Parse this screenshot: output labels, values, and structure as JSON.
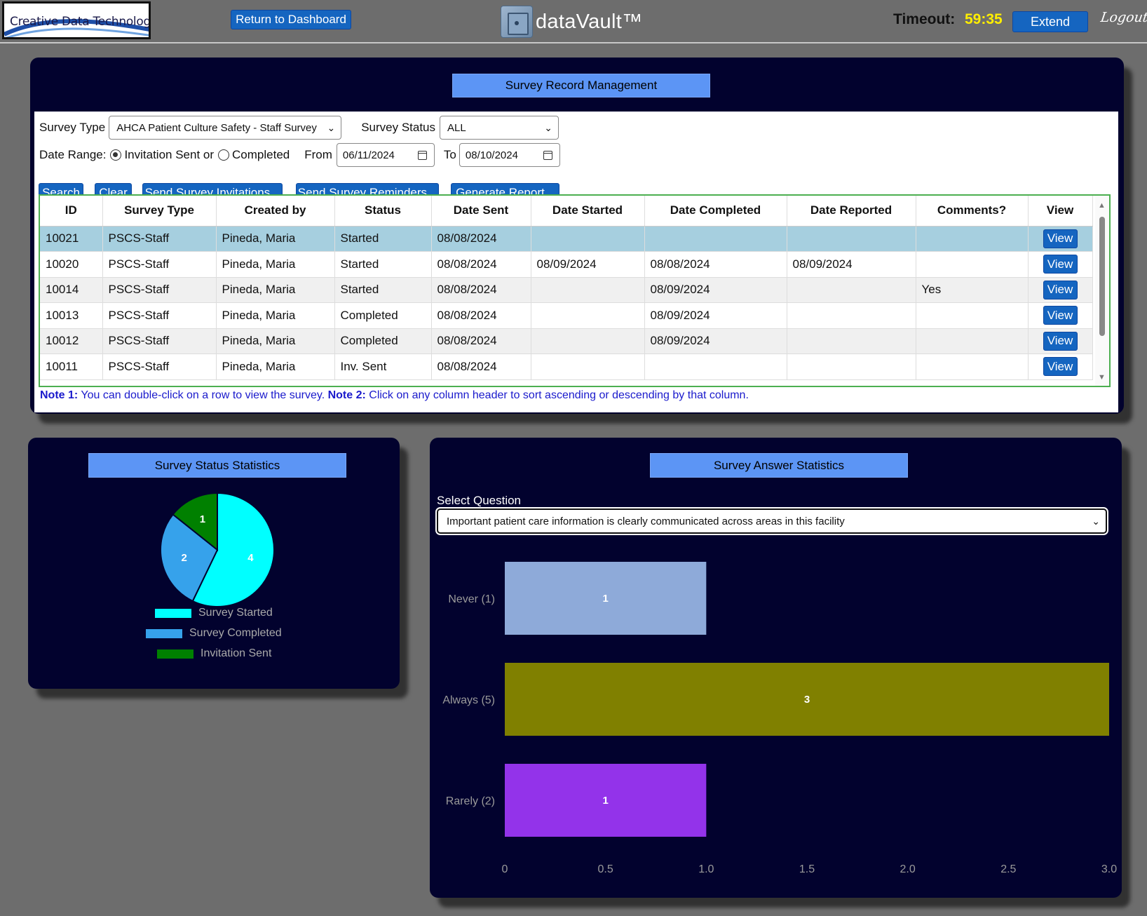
{
  "header": {
    "logo_text": "Creative Data Technologies",
    "dashboard_button": "Return to Dashboard",
    "brand_name": "dataVault™",
    "timeout_label": "Timeout:",
    "timeout_value": "59:35",
    "extend_button": "Extend",
    "logout_link": "Logout"
  },
  "management": {
    "title": "Survey Record Management",
    "survey_type_label": "Survey Type",
    "survey_type_value": "AHCA Patient Culture Safety - Staff Survey",
    "survey_status_label": "Survey Status",
    "survey_status_value": "ALL",
    "date_range_label": "Date Range:",
    "radio_invitation": "Invitation Sent or",
    "radio_completed": "Completed",
    "radio_selected": "invitation",
    "from_label": "From",
    "from_value": "06/11/2024",
    "to_label": "To",
    "to_value": "08/10/2024",
    "buttons": {
      "search": "Search",
      "clear": "Clear",
      "send_invitations": "Send Survey Invitations...",
      "send_reminders": "Send Survey Reminders...",
      "generate_report": "Generate Report..."
    },
    "table": {
      "columns": [
        "ID",
        "Survey Type",
        "Created by",
        "Status",
        "Date Sent",
        "Date Started",
        "Date Completed",
        "Date Reported",
        "Comments?",
        "View"
      ],
      "view_label": "View",
      "rows": [
        [
          "10021",
          "PSCS-Staff",
          "Pineda, Maria",
          "Started",
          "08/08/2024",
          "",
          "",
          "",
          ""
        ],
        [
          "10020",
          "PSCS-Staff",
          "Pineda, Maria",
          "Started",
          "08/08/2024",
          "08/09/2024",
          "08/08/2024",
          "08/09/2024",
          ""
        ],
        [
          "10014",
          "PSCS-Staff",
          "Pineda, Maria",
          "Started",
          "08/08/2024",
          "",
          "08/09/2024",
          "",
          "Yes"
        ],
        [
          "10013",
          "PSCS-Staff",
          "Pineda, Maria",
          "Completed",
          "08/08/2024",
          "",
          "08/09/2024",
          "",
          ""
        ],
        [
          "10012",
          "PSCS-Staff",
          "Pineda, Maria",
          "Completed",
          "08/08/2024",
          "",
          "08/09/2024",
          "",
          ""
        ],
        [
          "10011",
          "PSCS-Staff",
          "Pineda, Maria",
          "Inv. Sent",
          "08/08/2024",
          "",
          "",
          "",
          ""
        ]
      ]
    },
    "note1_label": "Note 1:",
    "note1_text": " You can double-click on a row to view the survey. ",
    "note2_label": "Note 2:",
    "note2_text": " Click on any column header to sort ascending or descending by that column."
  },
  "status_stats": {
    "title": "Survey Status Statistics",
    "chart_data": {
      "type": "pie",
      "slices": [
        {
          "label": "Survey Started",
          "value": 4,
          "color": "#00ffff"
        },
        {
          "label": "Survey Completed",
          "value": 2,
          "color": "#36a2eb"
        },
        {
          "label": "Invitation Sent",
          "value": 1,
          "color": "#008000"
        }
      ]
    }
  },
  "answer_stats": {
    "title": "Survey Answer Statistics",
    "question_label": "Select Question",
    "question_value": "Important patient care information is clearly communicated across areas in this facility",
    "chart_data": {
      "type": "bar",
      "orientation": "horizontal",
      "categories": [
        "Never (1)",
        "Always (5)",
        "Rarely (2)"
      ],
      "values": [
        1,
        3,
        1
      ],
      "colors": [
        "#8eaad9",
        "#808000",
        "#9333ea"
      ],
      "xlim": [
        0,
        3
      ],
      "xticks": [
        "0",
        "0.5",
        "1.0",
        "1.5",
        "2.0",
        "2.5",
        "3.0"
      ]
    }
  }
}
